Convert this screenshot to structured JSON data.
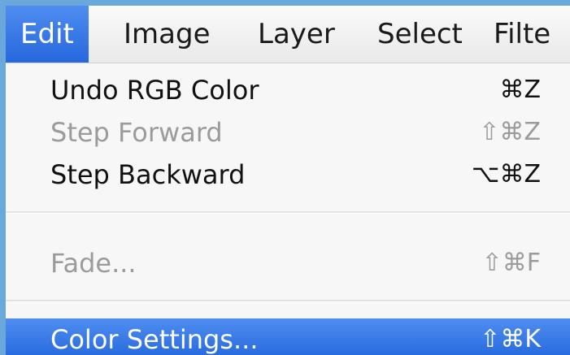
{
  "menubar": {
    "items": [
      {
        "label": "Edit",
        "active": true
      },
      {
        "label": "Image",
        "active": false
      },
      {
        "label": "Layer",
        "active": false
      },
      {
        "label": "Select",
        "active": false
      },
      {
        "label": "Filte",
        "active": false
      }
    ]
  },
  "menu": {
    "items": [
      {
        "label": "Undo RGB Color",
        "shortcut": "⌘Z",
        "enabled": true,
        "highlighted": false
      },
      {
        "label": "Step Forward",
        "shortcut": "⇧⌘Z",
        "enabled": false,
        "highlighted": false
      },
      {
        "label": "Step Backward",
        "shortcut": "⌥⌘Z",
        "enabled": true,
        "highlighted": false
      },
      {
        "label": "Fade...",
        "shortcut": "⇧⌘F",
        "enabled": false,
        "highlighted": false
      },
      {
        "label": "Color Settings...",
        "shortcut": "⇧⌘K",
        "enabled": true,
        "highlighted": true
      }
    ]
  },
  "colors": {
    "highlight": "#2e74e6",
    "frame_accent": "#6aa8dc",
    "disabled_text": "#9b9b9b"
  }
}
